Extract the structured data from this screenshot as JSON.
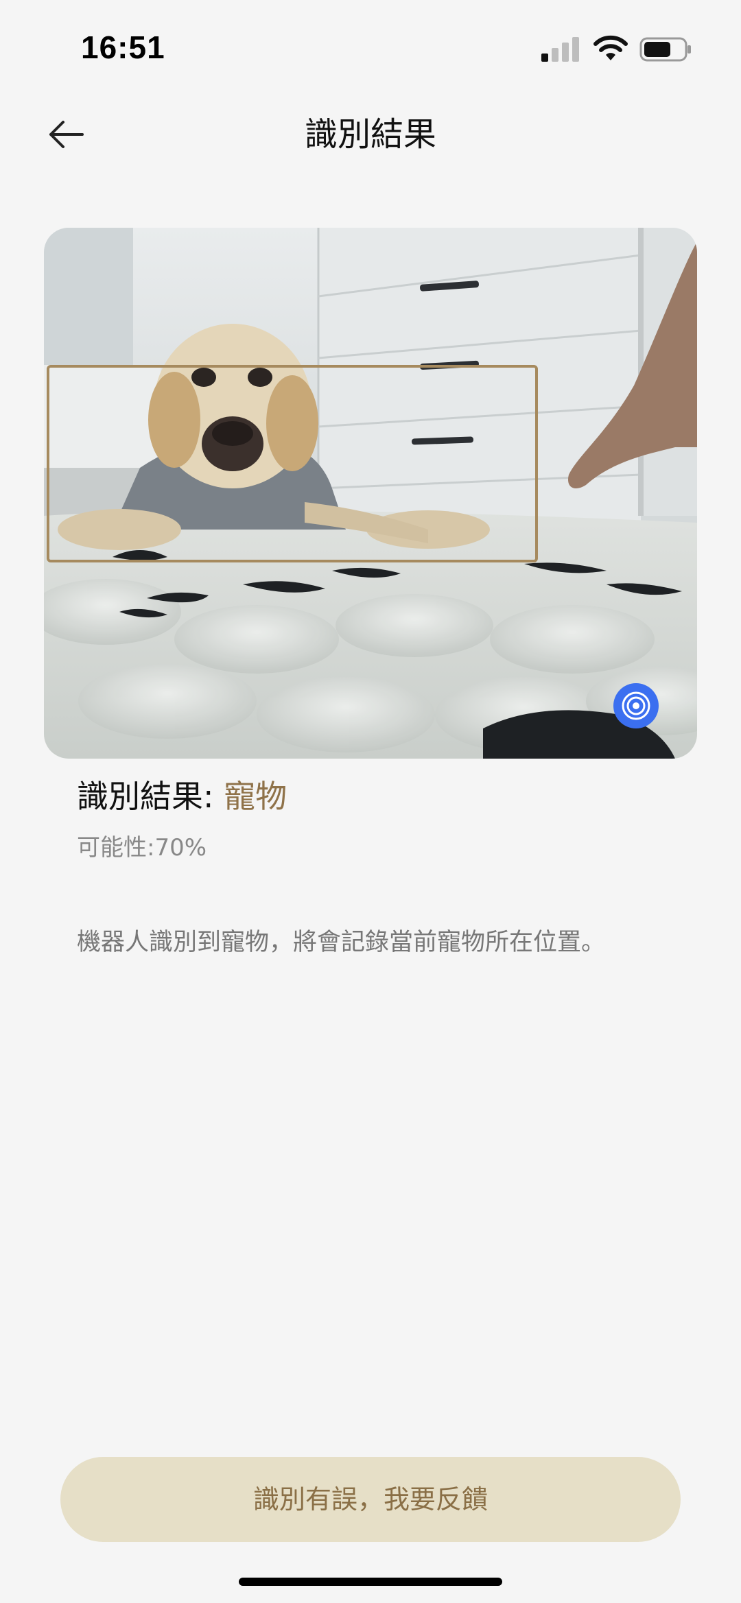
{
  "status_bar": {
    "time": "16:51",
    "signal_icon": "cellular-signal-icon",
    "wifi_icon": "wifi-icon",
    "battery_icon": "battery-icon"
  },
  "header": {
    "back_icon": "arrow-left-icon",
    "title": "識別結果"
  },
  "photo": {
    "subject": "dog",
    "detection_box_color": "#a68a5e",
    "lens_icon": "concentric-circles-icon",
    "lens_color": "#3b6ff0"
  },
  "result": {
    "label": "識別結果: ",
    "value": "寵物",
    "value_color": "#8f7249",
    "probability": "可能性:70%",
    "description": "機器人識別到寵物，將會記錄當前寵物所在位置。"
  },
  "feedback_button": {
    "label": "識別有誤，我要反饋",
    "background": "#e6dfc7",
    "text_color": "#8a6f46"
  }
}
